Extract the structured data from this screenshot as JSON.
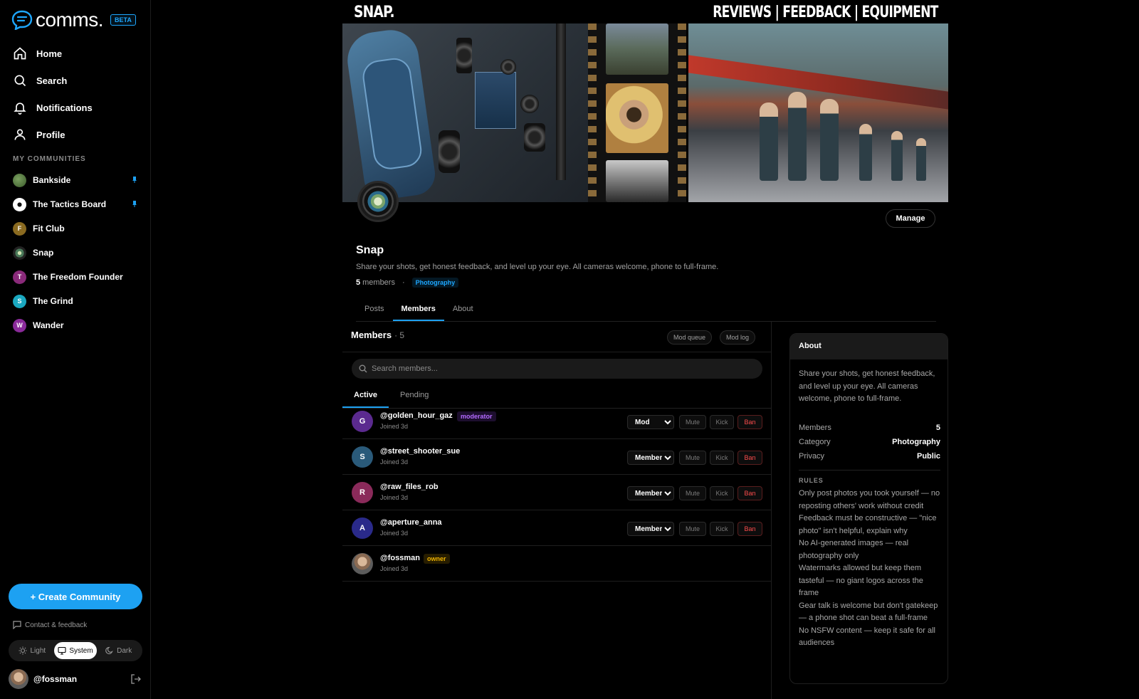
{
  "brand": {
    "name": "comms.",
    "badge": "BETA",
    "accent": "#1da1f2"
  },
  "nav": [
    {
      "label": "Home",
      "icon": "home-icon"
    },
    {
      "label": "Search",
      "icon": "search-icon"
    },
    {
      "label": "Notifications",
      "icon": "bell-icon"
    },
    {
      "label": "Profile",
      "icon": "user-icon"
    }
  ],
  "communities": {
    "label": "MY COMMUNITIES",
    "items": [
      {
        "name": "Bankside",
        "initial": "",
        "color": "#4a6a3a",
        "pinned": true
      },
      {
        "name": "The Tactics Board",
        "initial": "",
        "color": "#ffffff",
        "pinned": true
      },
      {
        "name": "Fit Club",
        "initial": "F",
        "color": "#8a6a20",
        "pinned": false
      },
      {
        "name": "Snap",
        "initial": "",
        "color": "#3a4a3a",
        "pinned": false
      },
      {
        "name": "The Freedom Founder",
        "initial": "T",
        "color": "#8a2a7a",
        "pinned": false
      },
      {
        "name": "The Grind",
        "initial": "S",
        "color": "#1aa8c0",
        "pinned": false
      },
      {
        "name": "Wander",
        "initial": "W",
        "color": "#8a2a9a",
        "pinned": false
      }
    ]
  },
  "create_label": "+ Create Community",
  "contact_label": "Contact & feedback",
  "theme": {
    "light": "Light",
    "system": "System",
    "dark": "Dark",
    "selected": "System"
  },
  "current_user": "@fossman",
  "banner": {
    "title": "SNAP.",
    "tagline": "REVIEWS | FEEDBACK | EQUIPMENT"
  },
  "manage_label": "Manage",
  "community": {
    "name": "Snap",
    "description": "Share your shots, get honest feedback, and level up your eye. All cameras welcome, phone to full-frame.",
    "member_count": "5",
    "members_word": "members",
    "category": "Photography"
  },
  "tabs": [
    "Posts",
    "Members",
    "About"
  ],
  "active_tab": "Members",
  "members": {
    "title": "Members",
    "count": "· 5",
    "mod_queue": "Mod queue",
    "mod_log": "Mod log",
    "search_placeholder": "Search members...",
    "subtabs": [
      "Active",
      "Pending"
    ],
    "list": [
      {
        "handle": "@golden_hour_gaz",
        "joined": "Joined 3d",
        "initial": "G",
        "color": "#5b2a8f",
        "badge": "moderator",
        "role": "Mod"
      },
      {
        "handle": "@street_shooter_sue",
        "joined": "Joined 3d",
        "initial": "S",
        "color": "#2a5a7a",
        "badge": "",
        "role": "Member"
      },
      {
        "handle": "@raw_files_rob",
        "joined": "Joined 3d",
        "initial": "R",
        "color": "#8a2a5a",
        "badge": "",
        "role": "Member"
      },
      {
        "handle": "@aperture_anna",
        "joined": "Joined 3d",
        "initial": "A",
        "color": "#2a2a8a",
        "badge": "",
        "role": "Member"
      },
      {
        "handle": "@fossman",
        "joined": "Joined 3d",
        "initial": "",
        "color": "#7a6a5a",
        "badge": "owner",
        "role": ""
      }
    ],
    "actions": {
      "mute": "Mute",
      "kick": "Kick",
      "ban": "Ban"
    },
    "role_options": [
      "Mod",
      "Member"
    ]
  },
  "about": {
    "title": "About",
    "description": "Share your shots, get honest feedback, and level up your eye. All cameras welcome, phone to full-frame.",
    "members_label": "Members",
    "members_value": "5",
    "category_label": "Category",
    "category_value": "Photography",
    "privacy_label": "Privacy",
    "privacy_value": "Public",
    "rules_label": "RULES",
    "rules": [
      "Only post photos you took yourself — no reposting others' work without credit",
      "Feedback must be constructive — \"nice photo\" isn't helpful, explain why",
      "No AI-generated images — real photography only",
      "Watermarks allowed but keep them tasteful — no giant logos across the frame",
      "Gear talk is welcome but don't gatekeep — a phone shot can beat a full-frame",
      "No NSFW content — keep it safe for all audiences"
    ]
  }
}
